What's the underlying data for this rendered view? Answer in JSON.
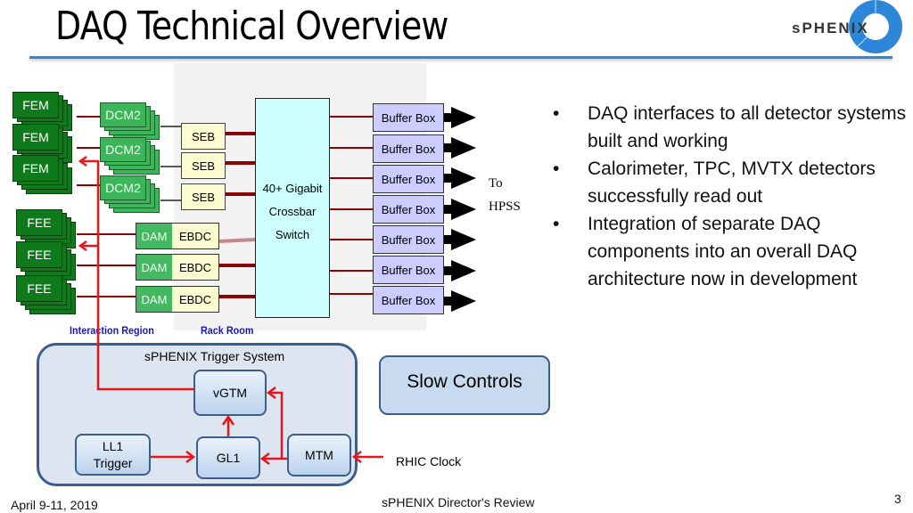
{
  "slide": {
    "title": "DAQ Technical Overview",
    "logo_text": "sPHENIX",
    "footer": {
      "date": "April 9-11, 2019",
      "center": "sPHENIX Director's Review",
      "page_number": "3"
    }
  },
  "diagram": {
    "fem_label": "FEM",
    "fee_label": "FEE",
    "dcm_label": "DCM2",
    "seb_label": "SEB",
    "dam_label": "DAM",
    "ebdc_label": "EBDC",
    "switch_lines": [
      "40+ Gigabit",
      "Crossbar",
      "Switch"
    ],
    "buffer_box_label": "Buffer Box",
    "buffer_box_count": 7,
    "hpss_lines": [
      "To",
      "HPSS"
    ],
    "region_labels": {
      "interaction_region": "Interaction Region",
      "rack_room": "Rack Room"
    },
    "trigger_system": {
      "title": "sPHENIX Trigger System",
      "vgtm": "vGTM",
      "ll1_lines": [
        "LL1",
        "Trigger"
      ],
      "gl1": "GL1",
      "mtm": "MTM"
    },
    "slow_controls": "Slow Controls",
    "rhic_clock": "RHIC Clock",
    "colors": {
      "fem_green": "#0f7a1c",
      "dcm_green": "#3cb55b",
      "seb_yellow": "#fdfbd0",
      "switch_cyan": "#ccfffe",
      "buffer_lavender": "#ccccff",
      "link_darkred": "#8b0000",
      "timing_red": "#e8161b",
      "title_rule_blue": "#2e86d9",
      "region_label_blue": "#1515c8"
    }
  },
  "bullets": [
    "DAQ interfaces to all detector systems built and working",
    "Calorimeter, TPC, MVTX detectors successfully read out",
    "Integration of separate DAQ components into an overall DAQ architecture now in development"
  ]
}
